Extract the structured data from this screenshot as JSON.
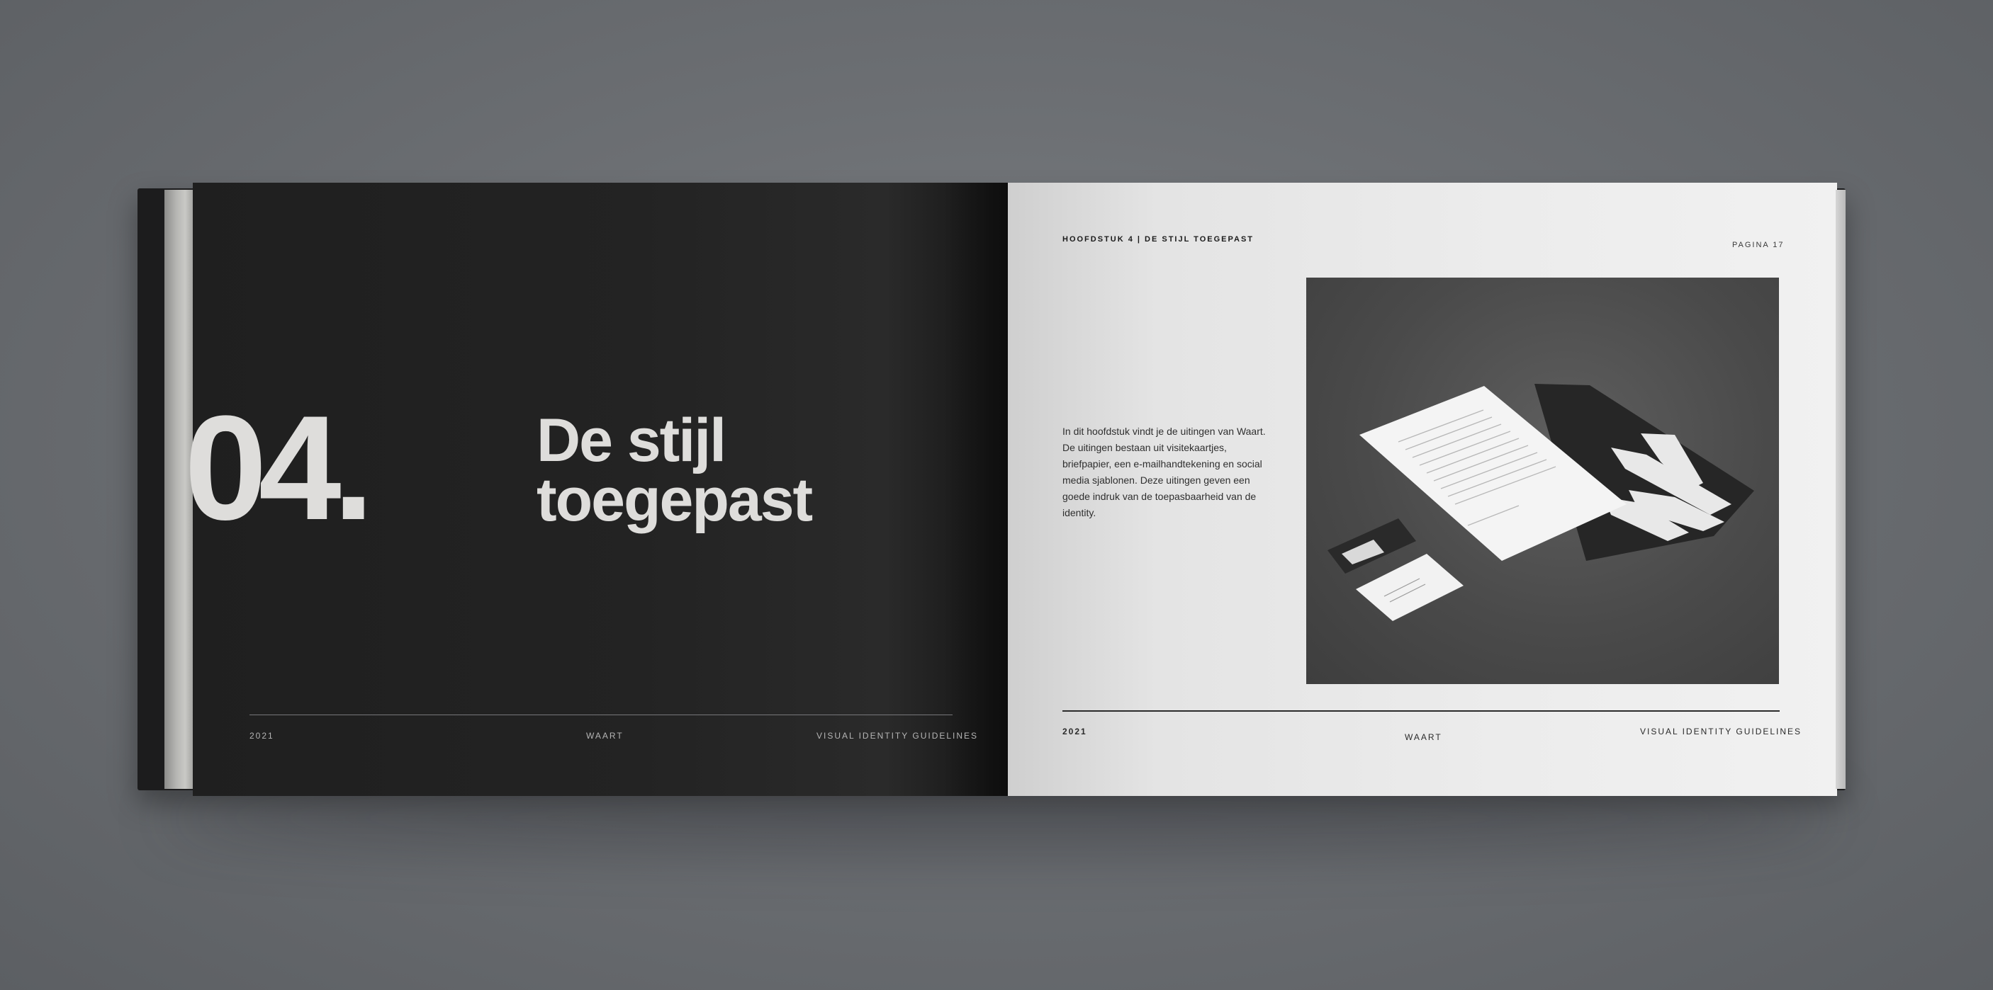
{
  "left_page": {
    "chapter_number": "04.",
    "chapter_title_line1": "De stijl",
    "chapter_title_line2": "toegepast",
    "footer": {
      "year": "2021",
      "brand": "WAART",
      "label": "VISUAL IDENTITY GUIDELINES"
    }
  },
  "right_page": {
    "header_title": "HOOFDSTUK 4 | DE STIJL TOEGEPAST",
    "header_page": "PAGINA 17",
    "intro_text": "In dit hoofdstuk vindt je de uitingen van Waart. De uitingen bestaan uit visitekaartjes, briefpapier, een e-mailhandtekening en social media sjablonen. Deze uitingen geven een goede indruk van de toepasbaarheid van de identity.",
    "photo_subject": "stationery-mockup",
    "footer": {
      "year": "2021",
      "brand": "WAART",
      "label": "VISUAL IDENTITY GUIDELINES"
    }
  },
  "colors": {
    "background": "#6c6f73",
    "dark_page": "#222222",
    "light_page": "#ececec",
    "headline": "#dedddb"
  }
}
